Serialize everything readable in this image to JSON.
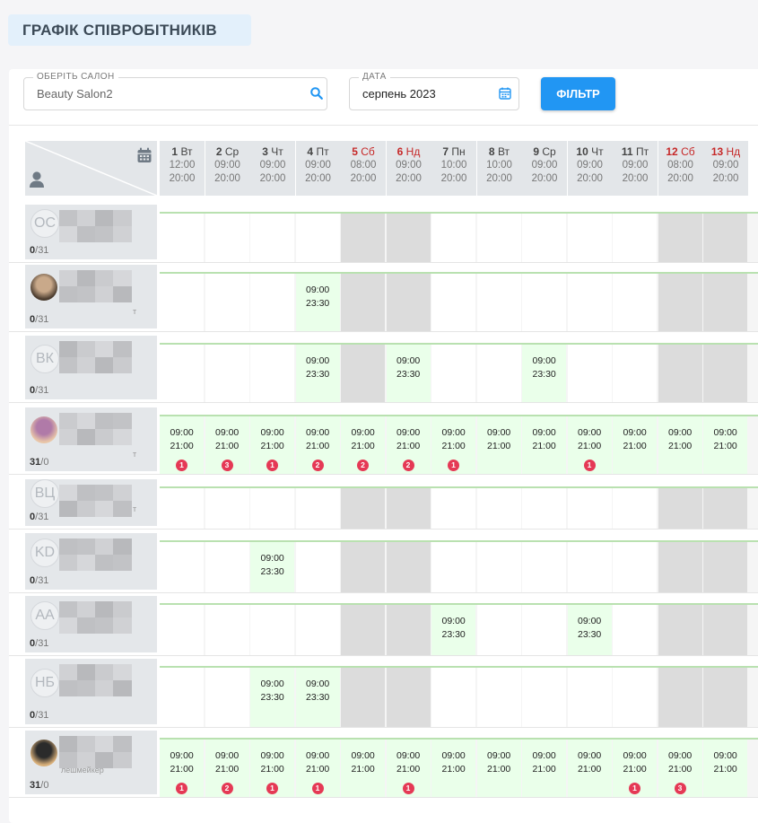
{
  "page": {
    "title": "ГРАФІК СПІВРОБІТНИКІВ"
  },
  "filters": {
    "salon_label": "ОБЕРІТЬ САЛОН",
    "salon_value": "Beauty Salon2",
    "date_label": "ДАТА",
    "date_value": "серпень 2023",
    "filter_button": "ФІЛЬТР"
  },
  "colors": {
    "accent": "#2196f3",
    "weekend": "#c62828",
    "shift": "#eaffea",
    "dayoff": "#dcdcdc",
    "badge": "#e53955"
  },
  "days": [
    {
      "num": "1",
      "dow": "Вт",
      "from": "12:00",
      "to": "20:00",
      "weekend": false
    },
    {
      "num": "2",
      "dow": "Ср",
      "from": "09:00",
      "to": "20:00",
      "weekend": false
    },
    {
      "num": "3",
      "dow": "Чт",
      "from": "09:00",
      "to": "20:00",
      "weekend": false
    },
    {
      "num": "4",
      "dow": "Пт",
      "from": "09:00",
      "to": "20:00",
      "weekend": false
    },
    {
      "num": "5",
      "dow": "Сб",
      "from": "08:00",
      "to": "20:00",
      "weekend": true
    },
    {
      "num": "6",
      "dow": "Нд",
      "from": "09:00",
      "to": "20:00",
      "weekend": true
    },
    {
      "num": "7",
      "dow": "Пн",
      "from": "10:00",
      "to": "20:00",
      "weekend": false
    },
    {
      "num": "8",
      "dow": "Вт",
      "from": "10:00",
      "to": "20:00",
      "weekend": false
    },
    {
      "num": "9",
      "dow": "Ср",
      "from": "09:00",
      "to": "20:00",
      "weekend": false
    },
    {
      "num": "10",
      "dow": "Чт",
      "from": "09:00",
      "to": "20:00",
      "weekend": false
    },
    {
      "num": "11",
      "dow": "Пт",
      "from": "09:00",
      "to": "20:00",
      "weekend": false
    },
    {
      "num": "12",
      "dow": "Сб",
      "from": "08:00",
      "to": "20:00",
      "weekend": true
    },
    {
      "num": "13",
      "dow": "Нд",
      "from": "09:00",
      "to": "20:00",
      "weekend": true
    }
  ],
  "employees": [
    {
      "initials": "ОС",
      "photo": false,
      "worked": "0",
      "total": "31",
      "role": "",
      "shifts": [
        null,
        null,
        null,
        null,
        null,
        null,
        null,
        null,
        null,
        null,
        null,
        null,
        null
      ],
      "badges": [
        null,
        null,
        null,
        null,
        null,
        null,
        null,
        null,
        null,
        null,
        null,
        null,
        null
      ]
    },
    {
      "initials": "",
      "photo": true,
      "worked": "0",
      "total": "31",
      "role": "т",
      "shifts": [
        null,
        null,
        null,
        {
          "from": "09:00",
          "to": "23:30"
        },
        null,
        null,
        null,
        null,
        null,
        null,
        null,
        null,
        null
      ],
      "badges": [
        null,
        null,
        null,
        null,
        null,
        null,
        null,
        null,
        null,
        null,
        null,
        null,
        null
      ]
    },
    {
      "initials": "ВК",
      "photo": false,
      "worked": "0",
      "total": "31",
      "role": "",
      "shifts": [
        null,
        null,
        null,
        {
          "from": "09:00",
          "to": "23:30"
        },
        null,
        {
          "from": "09:00",
          "to": "23:30"
        },
        null,
        null,
        {
          "from": "09:00",
          "to": "23:30"
        },
        null,
        null,
        null,
        null
      ],
      "badges": [
        null,
        null,
        null,
        null,
        null,
        null,
        null,
        null,
        null,
        null,
        null,
        null,
        null
      ]
    },
    {
      "initials": "",
      "photo": true,
      "worked": "31",
      "total": "0",
      "role": "т",
      "shifts": [
        {
          "from": "09:00",
          "to": "21:00"
        },
        {
          "from": "09:00",
          "to": "21:00"
        },
        {
          "from": "09:00",
          "to": "21:00"
        },
        {
          "from": "09:00",
          "to": "21:00"
        },
        {
          "from": "09:00",
          "to": "21:00"
        },
        {
          "from": "09:00",
          "to": "21:00"
        },
        {
          "from": "09:00",
          "to": "21:00"
        },
        {
          "from": "09:00",
          "to": "21:00"
        },
        {
          "from": "09:00",
          "to": "21:00"
        },
        {
          "from": "09:00",
          "to": "21:00"
        },
        {
          "from": "09:00",
          "to": "21:00"
        },
        {
          "from": "09:00",
          "to": "21:00"
        },
        {
          "from": "09:00",
          "to": "21:00"
        }
      ],
      "badges": [
        "1",
        "3",
        "1",
        "2",
        "2",
        "2",
        "1",
        null,
        null,
        "1",
        null,
        null,
        null
      ]
    },
    {
      "initials": "ВЦ",
      "photo": false,
      "worked": "0",
      "total": "31",
      "role": "т",
      "shifts": [
        null,
        null,
        null,
        null,
        null,
        null,
        null,
        null,
        null,
        null,
        null,
        null,
        null
      ],
      "badges": [
        null,
        null,
        null,
        null,
        null,
        null,
        null,
        null,
        null,
        null,
        null,
        null,
        null
      ]
    },
    {
      "initials": "KD",
      "photo": false,
      "worked": "0",
      "total": "31",
      "role": "",
      "shifts": [
        null,
        null,
        {
          "from": "09:00",
          "to": "23:30"
        },
        null,
        null,
        null,
        null,
        null,
        null,
        null,
        null,
        null,
        null
      ],
      "badges": [
        null,
        null,
        null,
        null,
        null,
        null,
        null,
        null,
        null,
        null,
        null,
        null,
        null
      ]
    },
    {
      "initials": "AA",
      "photo": false,
      "worked": "0",
      "total": "31",
      "role": "",
      "shifts": [
        null,
        null,
        null,
        null,
        null,
        null,
        {
          "from": "09:00",
          "to": "23:30"
        },
        null,
        null,
        {
          "from": "09:00",
          "to": "23:30"
        },
        null,
        null,
        null
      ],
      "badges": [
        null,
        null,
        null,
        null,
        null,
        null,
        null,
        null,
        null,
        null,
        null,
        null,
        null
      ]
    },
    {
      "initials": "НБ",
      "photo": false,
      "worked": "0",
      "total": "31",
      "role": "",
      "shifts": [
        null,
        null,
        {
          "from": "09:00",
          "to": "23:30"
        },
        {
          "from": "09:00",
          "to": "23:30"
        },
        null,
        null,
        null,
        null,
        null,
        null,
        null,
        null,
        null
      ],
      "badges": [
        null,
        null,
        null,
        null,
        null,
        null,
        null,
        null,
        null,
        null,
        null,
        null,
        null
      ]
    },
    {
      "initials": "",
      "photo": true,
      "worked": "31",
      "total": "0",
      "role": "лешмейкер",
      "shifts": [
        {
          "from": "09:00",
          "to": "21:00"
        },
        {
          "from": "09:00",
          "to": "21:00"
        },
        {
          "from": "09:00",
          "to": "21:00"
        },
        {
          "from": "09:00",
          "to": "21:00"
        },
        {
          "from": "09:00",
          "to": "21:00"
        },
        {
          "from": "09:00",
          "to": "21:00"
        },
        {
          "from": "09:00",
          "to": "21:00"
        },
        {
          "from": "09:00",
          "to": "21:00"
        },
        {
          "from": "09:00",
          "to": "21:00"
        },
        {
          "from": "09:00",
          "to": "21:00"
        },
        {
          "from": "09:00",
          "to": "21:00"
        },
        {
          "from": "09:00",
          "to": "21:00"
        },
        {
          "from": "09:00",
          "to": "21:00"
        }
      ],
      "badges": [
        "1",
        "2",
        "1",
        "1",
        null,
        "1",
        null,
        null,
        null,
        null,
        "1",
        "3",
        null
      ]
    }
  ]
}
